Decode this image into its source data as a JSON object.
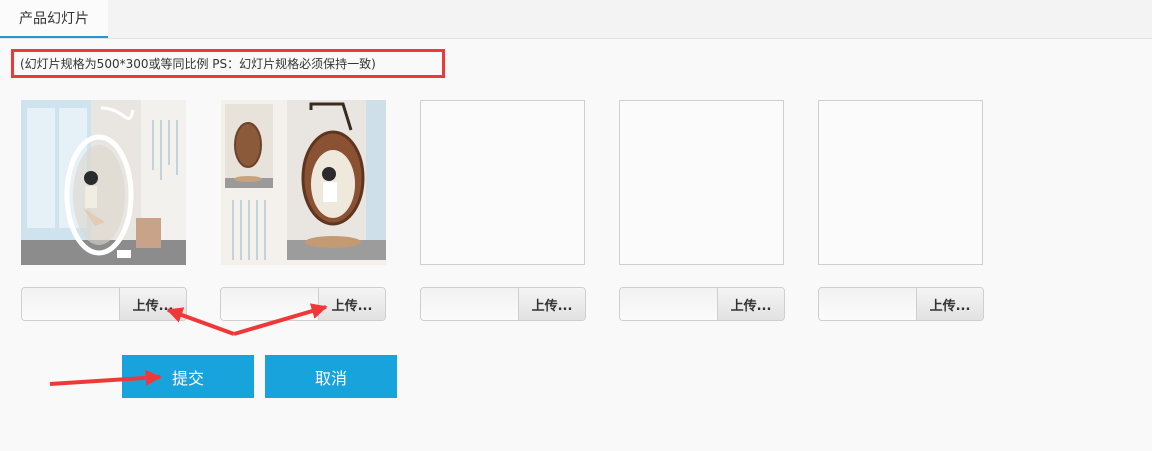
{
  "tabs": [
    {
      "label": "产品幻灯片"
    }
  ],
  "notice": "(幻灯片规格为500*300或等同比例   PS：幻灯片规格必须保持一致)",
  "slots": [
    {
      "state": "uploaded",
      "upload_label": "上传..."
    },
    {
      "state": "uploaded",
      "upload_label": "上传..."
    },
    {
      "state": "empty",
      "upload_label": "上传..."
    },
    {
      "state": "empty",
      "upload_label": "上传..."
    },
    {
      "state": "empty",
      "upload_label": "上传..."
    }
  ],
  "actions": {
    "submit_label": "提交",
    "cancel_label": "取消"
  },
  "colors": {
    "accent": "#19a3dc",
    "annotation": "#ef3838",
    "tab_underline": "#1d9bd8"
  }
}
